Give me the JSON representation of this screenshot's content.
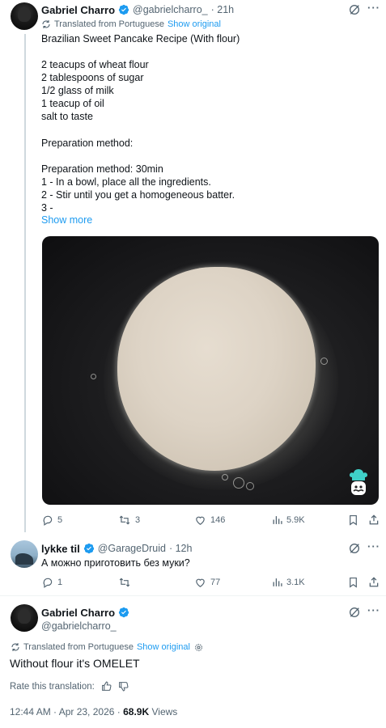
{
  "tweet1": {
    "author_name": "Gabriel Charro",
    "author_handle": "@gabrielcharro_",
    "time": "· 21h",
    "translated_label": "Translated from Portuguese",
    "show_original": "Show original",
    "title": "Brazilian Sweet Pancake Recipe (With flour)",
    "ingredients": [
      "2 teacups of wheat flour",
      "2 tablespoons of sugar",
      "1/2 glass of milk",
      "1 teacup of oil",
      "salt to taste"
    ],
    "prep_heading": "Preparation method:",
    "prep_lines": [
      "Preparation method: 30min",
      "1 - In a bowl, place all the ingredients.",
      "2 - Stir until you get a homogeneous batter.",
      "3 -"
    ],
    "show_more": "Show more",
    "stats": {
      "replies": "5",
      "reposts": "3",
      "likes": "146",
      "views": "5.9K"
    }
  },
  "reply": {
    "author_name": "lykke til",
    "author_handle": "@GarageDruid",
    "time": "· 12h",
    "text": "А можно приготовить без муки?",
    "stats": {
      "replies": "1",
      "reposts": "",
      "likes": "77",
      "views": "3.1K"
    }
  },
  "main": {
    "author_name": "Gabriel Charro",
    "author_handle": "@gabrielcharro_",
    "translated_label": "Translated from Portuguese",
    "show_original": "Show original",
    "text": "Without flour it's OMELET",
    "rate_label": "Rate this translation:",
    "timestamp": "12:44 AM · Apr 23, 2026 ·",
    "views_count": "68.9K",
    "views_label": "Views"
  },
  "colors": {
    "accent": "#1d9bf0",
    "text": "#0f1419",
    "muted": "#536471"
  },
  "icons": [
    "verified-badge-icon",
    "grok-icon",
    "more-icon",
    "translate-icon",
    "reply-icon",
    "repost-icon",
    "like-icon",
    "views-icon",
    "bookmark-icon",
    "share-icon",
    "gear-icon",
    "thumbs-up-icon",
    "thumbs-down-icon"
  ]
}
